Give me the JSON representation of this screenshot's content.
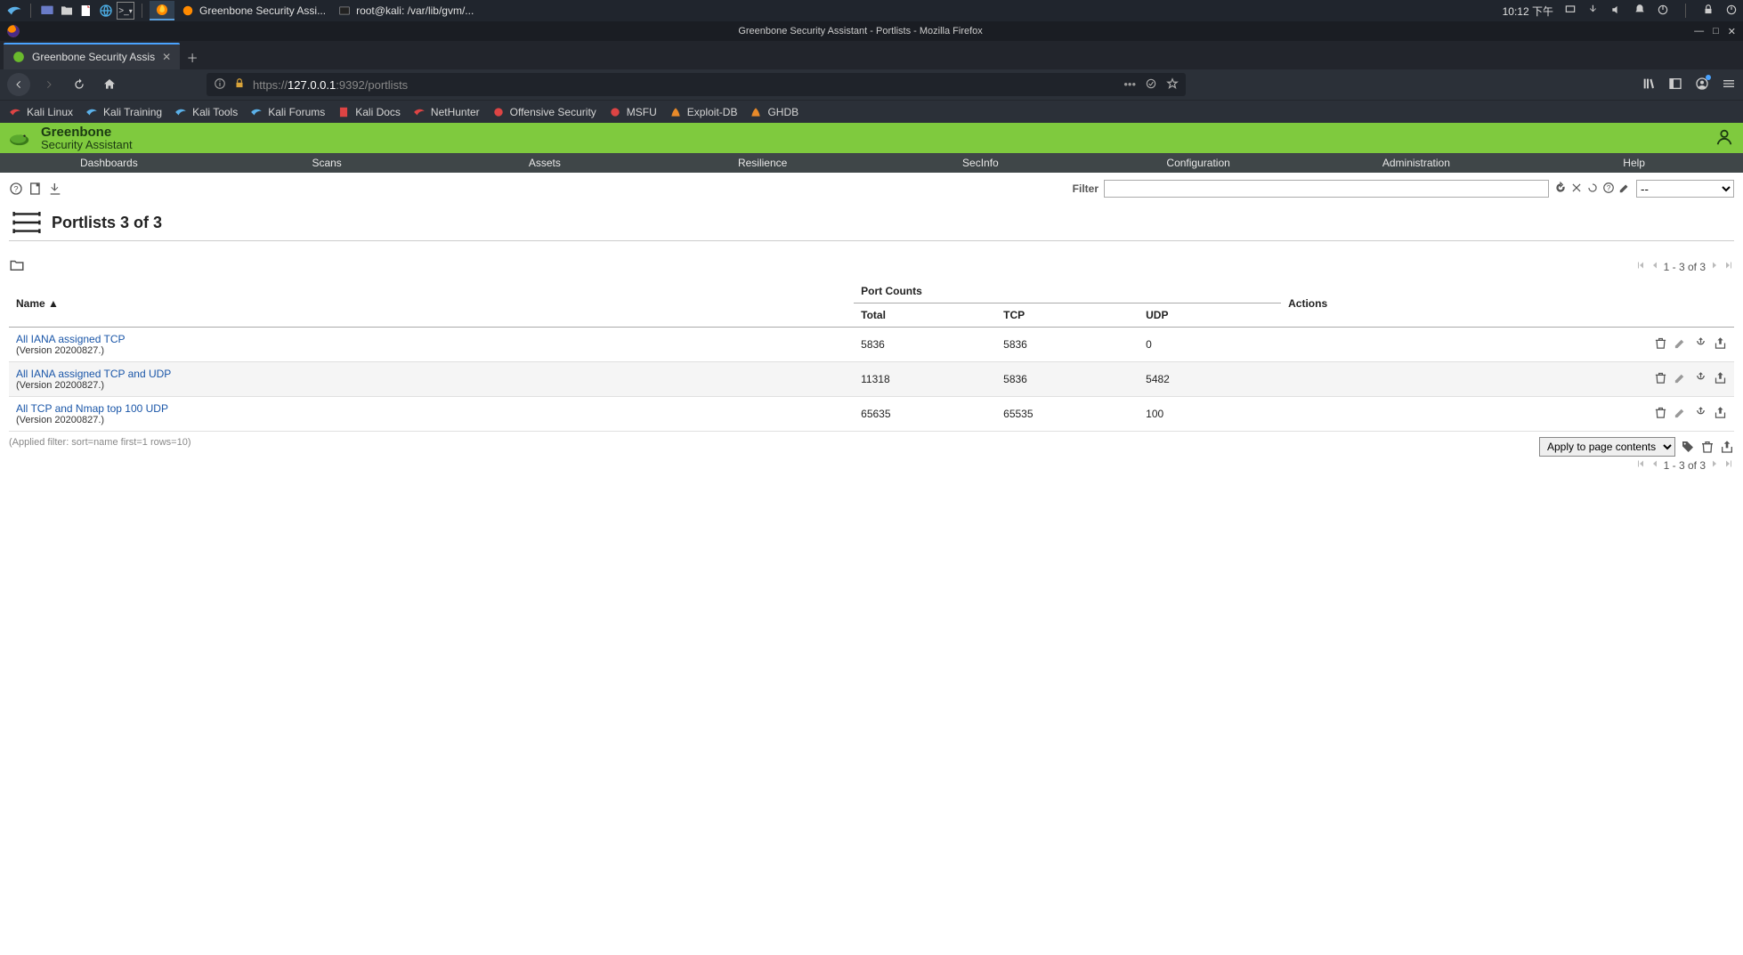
{
  "taskbar": {
    "app1": "Greenbone Security Assi...",
    "app2": "root@kali: /var/lib/gvm/...",
    "clock": "10:12 下午"
  },
  "titlebar": {
    "title": "Greenbone Security Assistant - Portlists - Mozilla Firefox"
  },
  "tab": {
    "label": "Greenbone Security Assis"
  },
  "url": {
    "proto": "https://",
    "host": "127.0.0.1",
    "rest": ":9392/portlists"
  },
  "bookmarks": [
    "Kali Linux",
    "Kali Training",
    "Kali Tools",
    "Kali Forums",
    "Kali Docs",
    "NetHunter",
    "Offensive Security",
    "MSFU",
    "Exploit-DB",
    "GHDB"
  ],
  "gb": {
    "title1": "Greenbone",
    "title2": "Security Assistant"
  },
  "gbnav": [
    "Dashboards",
    "Scans",
    "Assets",
    "Resilience",
    "SecInfo",
    "Configuration",
    "Administration",
    "Help"
  ],
  "filter": {
    "label": "Filter",
    "value": "",
    "dropdown": "--"
  },
  "page_title": "Portlists 3 of 3",
  "pager": "1 - 3 of 3",
  "table": {
    "name_header": "Name ▲",
    "portcounts_header": "Port Counts",
    "total_header": "Total",
    "tcp_header": "TCP",
    "udp_header": "UDP",
    "actions_header": "Actions",
    "rows": [
      {
        "name": "All IANA assigned TCP",
        "ver": "(Version 20200827.)",
        "total": "5836",
        "tcp": "5836",
        "udp": "0"
      },
      {
        "name": "All IANA assigned TCP and UDP",
        "ver": "(Version 20200827.)",
        "total": "11318",
        "tcp": "5836",
        "udp": "5482"
      },
      {
        "name": "All TCP and Nmap top 100 UDP",
        "ver": "(Version 20200827.)",
        "total": "65635",
        "tcp": "65535",
        "udp": "100"
      }
    ]
  },
  "apply_select": "Apply to page contents",
  "applied_filter": "(Applied filter: sort=name first=1 rows=10)"
}
